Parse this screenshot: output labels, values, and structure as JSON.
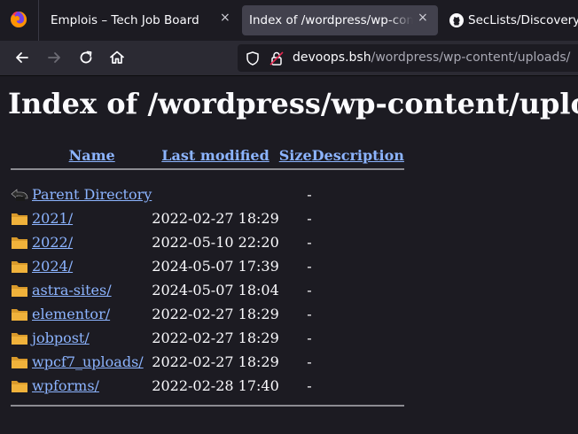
{
  "tabs": [
    {
      "label": "Emplois – Tech Job Board",
      "active": false,
      "close": "×"
    },
    {
      "label": "Index of /wordpress/wp-content/uploads",
      "active": true,
      "close": "×"
    },
    {
      "label": "SecLists/Discovery/W",
      "active": false
    }
  ],
  "urlbar": {
    "domain": "devoops.bsh",
    "path": "/wordpress/wp-content/uploads/"
  },
  "page": {
    "title": "Index of /wordpress/wp-content/uploads",
    "headers": {
      "name": "Name",
      "last_modified": "Last modified",
      "size": "Size",
      "description": "Description"
    },
    "parent": {
      "name": "Parent Directory",
      "size": "-"
    },
    "entries": [
      {
        "name": "2021/",
        "modified": "2022-02-27 18:29",
        "size": "-"
      },
      {
        "name": "2022/",
        "modified": "2022-05-10 22:20",
        "size": "-"
      },
      {
        "name": "2024/",
        "modified": "2024-05-07 17:39",
        "size": "-"
      },
      {
        "name": "astra-sites/",
        "modified": "2024-05-07 18:04",
        "size": "-"
      },
      {
        "name": "elementor/",
        "modified": "2022-02-27 18:29",
        "size": "-"
      },
      {
        "name": "jobpost/",
        "modified": "2022-02-27 18:29",
        "size": "-"
      },
      {
        "name": "wpcf7_uploads/",
        "modified": "2022-02-27 18:29",
        "size": "-"
      },
      {
        "name": "wpforms/",
        "modified": "2022-02-28 17:40",
        "size": "-"
      }
    ]
  },
  "icons": {
    "browser": "firefox-icon",
    "tab3": "github-icon",
    "back": "back-arrow-icon",
    "forward": "forward-arrow-icon",
    "reload": "reload-icon",
    "home": "home-icon",
    "tracking": "shield-icon",
    "security": "insecure-lock-icon",
    "folder": "folder-icon",
    "parent": "back-folder-icon"
  },
  "colors": {
    "link": "#8cb4ff",
    "background": "#1c1b22",
    "toolbar": "#2b2a33",
    "active_tab": "#42414d",
    "folder": "#f0b23b"
  }
}
